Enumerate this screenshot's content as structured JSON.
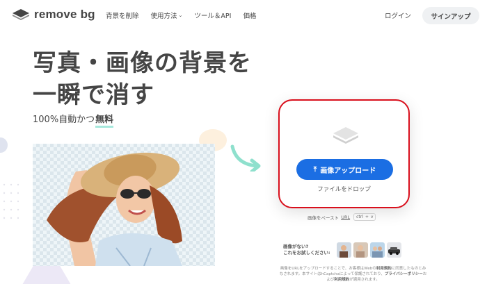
{
  "brand": {
    "name": "remove bg"
  },
  "nav": [
    {
      "label": "背景を削除"
    },
    {
      "label": "使用方法",
      "has_dropdown": true
    },
    {
      "label": "ツール＆API"
    },
    {
      "label": "価格"
    }
  ],
  "header": {
    "login": "ログイン",
    "signup": "サインアップ"
  },
  "hero": {
    "headline_line1": "写真・画像の背景を",
    "headline_line2": "一瞬で消す",
    "sub_prefix": "100%自動かつ",
    "sub_strong": "無料"
  },
  "upload": {
    "button_label": "画像アップロード",
    "drop_text": "ファイルをドロップ",
    "paste_text": "画像をペースト",
    "paste_url": "URL",
    "kbd_ctrl": "ctrl",
    "kbd_plus": "+",
    "kbd_v": "v"
  },
  "samples": {
    "line1": "画像がない?",
    "line2": "これをお試しください:"
  },
  "legal": {
    "text1": "画像をURLをアップロードすることで、お客様はWebの",
    "bold1": "利用規約",
    "text2": "に同意したものとみなされます。本サイトはhCaptchaによって保護されており、",
    "bold2": "プライバシーポリシー",
    "text3": "および",
    "bold3": "利用規約",
    "text4": "が適用されます。"
  },
  "colors": {
    "primary_blue": "#1b6ee3",
    "highlight_red": "#d90f1c",
    "text_dark": "#454545",
    "accent_mint": "#a6e8dc"
  }
}
